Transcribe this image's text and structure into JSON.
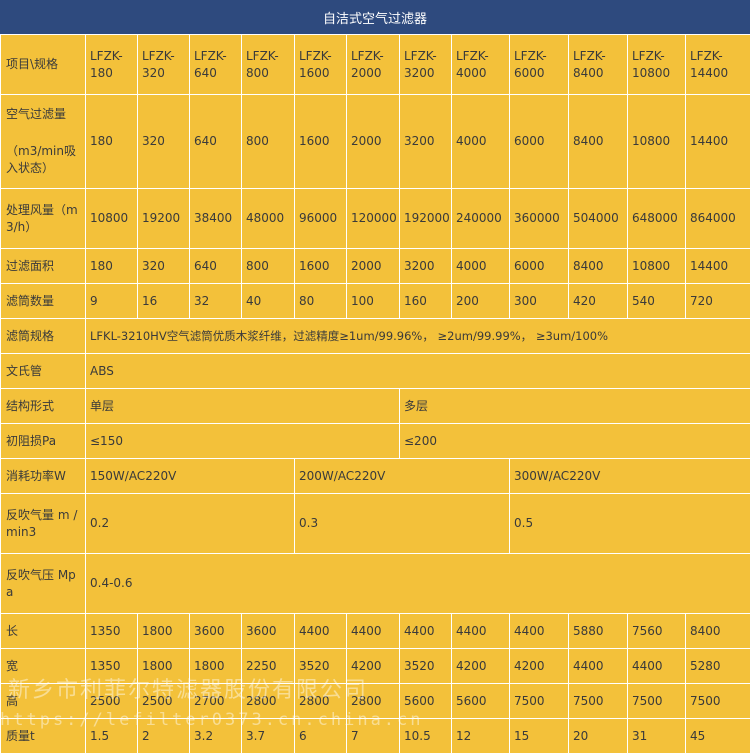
{
  "title": "自洁式空气过滤器",
  "header": {
    "label": "项目\\规格",
    "models": [
      [
        "LFZK-",
        "180"
      ],
      [
        "LFZK-",
        "320"
      ],
      [
        "LFZK-",
        "640"
      ],
      [
        "LFZK-",
        "800"
      ],
      [
        "LFZK-",
        "1600"
      ],
      [
        "LFZK-",
        "2000"
      ],
      [
        "LFZK-",
        "3200"
      ],
      [
        "LFZK-",
        "4000"
      ],
      [
        "LFZK-",
        "6000"
      ],
      [
        "LFZK-",
        "8400"
      ],
      [
        "LFZK-",
        "10800"
      ],
      [
        "LFZK-",
        "14400"
      ]
    ]
  },
  "rows": {
    "air_volume": {
      "label_line1": "空气过滤量",
      "label_line2": "（m3/min吸入状态）",
      "values": [
        "180",
        "320",
        "640",
        "800",
        "1600",
        "2000",
        "3200",
        "4000",
        "6000",
        "8400",
        "10800",
        "14400"
      ]
    },
    "flow": {
      "label": "处理风量（m3/h）",
      "values": [
        "10800",
        "19200",
        "38400",
        "48000",
        "96000",
        "120000",
        "192000",
        "240000",
        "360000",
        "504000",
        "648000",
        "864000"
      ]
    },
    "filter_area": {
      "label": "过滤面积",
      "values": [
        "180",
        "320",
        "640",
        "800",
        "1600",
        "2000",
        "3200",
        "4000",
        "6000",
        "8400",
        "10800",
        "14400"
      ]
    },
    "cartridge_count": {
      "label": "滤筒数量",
      "values": [
        "9",
        "16",
        "32",
        "40",
        "80",
        "100",
        "160",
        "200",
        "300",
        "420",
        "540",
        "720"
      ]
    },
    "cartridge_spec": {
      "label": "滤筒规格",
      "value": "LFKL-3210HV空气滤筒优质木浆纤维，过滤精度≥1um/99.96%， ≥2um/99.99%， ≥3um/100%"
    },
    "venturi": {
      "label": "文氏管",
      "value": "ABS"
    },
    "structure": {
      "label": "结构形式",
      "values": [
        "单层",
        "多层"
      ]
    },
    "initial_resistance": {
      "label": "初阻损Pa",
      "values": [
        "≤150",
        "≤200"
      ]
    },
    "power": {
      "label": "消耗功率W",
      "values": [
        "150W/AC220V",
        "200W/AC220V",
        "300W/AC220V"
      ]
    },
    "blowback_volume": {
      "label": "反吹气量 m /min3",
      "values": [
        "0.2",
        "0.3",
        "0.5"
      ]
    },
    "blowback_pressure": {
      "label": "反吹气压 Mpa",
      "value": "0.4-0.6"
    },
    "length": {
      "label": "长",
      "values": [
        "1350",
        "1800",
        "3600",
        "3600",
        "4400",
        "4400",
        "4400",
        "4400",
        "4400",
        "5880",
        "7560",
        "8400"
      ]
    },
    "width": {
      "label": "宽",
      "values": [
        "1350",
        "1800",
        "1800",
        "2250",
        "3520",
        "4200",
        "3520",
        "4200",
        "4200",
        "4400",
        "4400",
        "5280"
      ]
    },
    "height": {
      "label": "高",
      "values": [
        "2500",
        "2500",
        "2700",
        "2800",
        "2800",
        "2800",
        "5600",
        "5600",
        "7500",
        "7500",
        "7500",
        "7500"
      ]
    },
    "weight": {
      "label": "质量t",
      "values": [
        "1.5",
        "2",
        "3.2",
        "3.7",
        "6",
        "7",
        "10.5",
        "12",
        "15",
        "20",
        "31",
        "45"
      ]
    }
  },
  "watermark": {
    "company": "新乡市利菲尔特滤器股份有限公司",
    "url": "https://lefilter0373.cn.china.cn"
  }
}
